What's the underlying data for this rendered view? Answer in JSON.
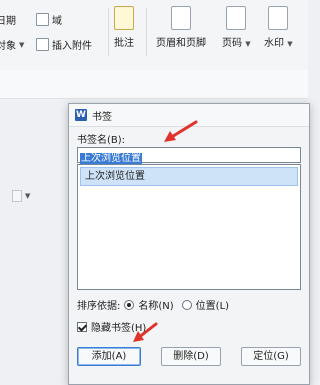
{
  "ribbon": {
    "row1_a": "日期",
    "row1_b": "域",
    "row2_a": "对象",
    "row2_b": "插入附件",
    "comment": "批注",
    "header_footer": "页眉和页脚",
    "page_number": "页码",
    "watermark": "水印"
  },
  "dialog": {
    "title": "书签",
    "name_label": "书签名(B):",
    "name_value": "上次浏览位置",
    "list": [
      "上次浏览位置"
    ],
    "sort_label": "排序依据:",
    "sort_by_name": "名称(N)",
    "sort_by_position": "位置(L)",
    "hide_label": "隐藏书签(H)",
    "buttons": {
      "add": "添加(A)",
      "delete": "删除(D)",
      "goto": "定位(G)"
    }
  },
  "colors": {
    "arrow": "#e0332c",
    "selection": "#3a7bd5",
    "list_highlight": "#cfe3f8",
    "logo": "#2b5fb0"
  }
}
